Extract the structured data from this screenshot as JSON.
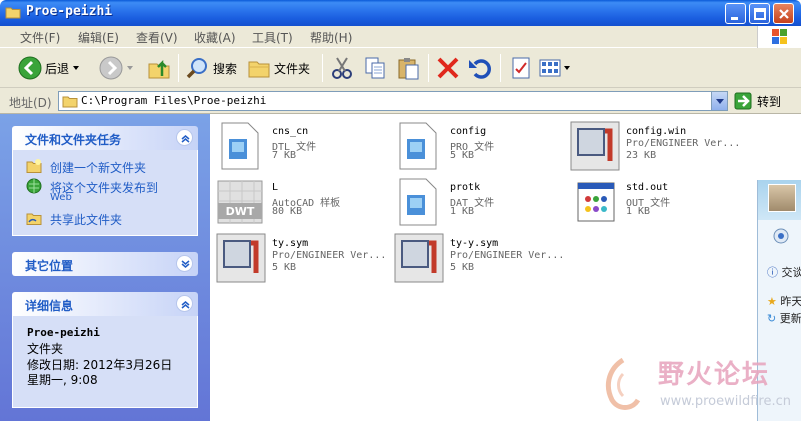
{
  "window": {
    "title": "Proe-peizhi"
  },
  "menu": [
    "文件(F)",
    "编辑(E)",
    "查看(V)",
    "收藏(A)",
    "工具(T)",
    "帮助(H)"
  ],
  "toolbar": {
    "back": "后退",
    "search": "搜索",
    "folders": "文件夹"
  },
  "address": {
    "label": "地址(D)",
    "path": "C:\\Program Files\\Proe-peizhi",
    "go": "转到"
  },
  "taskpane": {
    "file_tasks": {
      "title": "文件和文件夹任务",
      "items": [
        "创建一个新文件夹",
        "将这个文件夹发布到",
        "Web",
        "共享此文件夹"
      ]
    },
    "other_places": {
      "title": "其它位置"
    },
    "details": {
      "title": "详细信息",
      "name": "Proe-peizhi",
      "type": "文件夹",
      "modified": "修改日期: 2012年3月26日",
      "time": "星期一, 9:08"
    }
  },
  "files": [
    {
      "name": "cns_cn",
      "type": "DTL 文件",
      "size": "7 KB",
      "icon": "text-document-icon"
    },
    {
      "name": "config",
      "type": "PRO 文件",
      "size": "5 KB",
      "icon": "text-document-icon"
    },
    {
      "name": "config.win",
      "type": "Pro/ENGINEER Ver...",
      "size": "23 KB",
      "icon": "proe-icon"
    },
    {
      "name": "L",
      "type": "AutoCAD 样板",
      "size": "80 KB",
      "icon": "dwt-icon"
    },
    {
      "name": "protk",
      "type": "DAT 文件",
      "size": "1 KB",
      "icon": "text-document-icon"
    },
    {
      "name": "std.out",
      "type": "OUT 文件",
      "size": "1 KB",
      "icon": "app-window-icon"
    },
    {
      "name": "ty.sym",
      "type": "Pro/ENGINEER Ver...",
      "size": "5 KB",
      "icon": "proe-icon"
    },
    {
      "name": "ty-y.sym",
      "type": "Pro/ENGINEER Ver...",
      "size": "5 KB",
      "icon": "proe-icon"
    }
  ],
  "overlay": {
    "items": [
      "交谈",
      "昨天",
      "更新"
    ]
  },
  "watermark": {
    "title": "野火论坛",
    "url": "www.proewildfire.cn"
  },
  "colors": {
    "titlebar": "#2a74ec",
    "taskpane": "#6f8ee0",
    "link": "#215dc6",
    "close": "#d5542c"
  }
}
